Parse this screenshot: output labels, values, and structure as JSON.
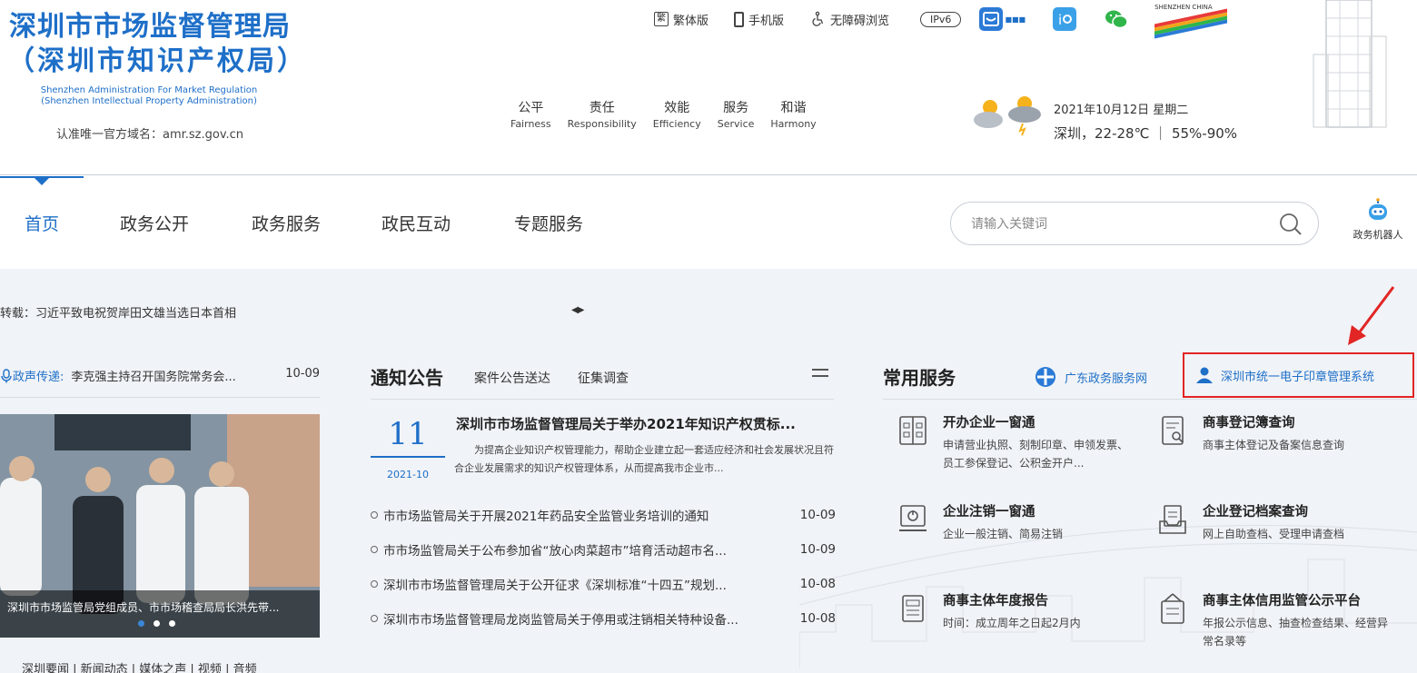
{
  "header": {
    "logo_cn_line1": "深圳市市场监督管理局",
    "logo_cn_line2": "（深圳市知识产权局）",
    "logo_en_line1": "Shenzhen Administration For Market Regulation",
    "logo_en_line2": "(Shenzhen Intellectual Property Administration)",
    "domain_note": "认准唯一官方域名：amr.sz.gov.cn",
    "toplinks": {
      "traditional_badge": "繁",
      "traditional": "繁体版",
      "mobile": "手机版",
      "accessible": "无障碍浏览",
      "ipv6": "IPv6"
    },
    "brand_text": "SHENZHEN CHINA",
    "values": [
      {
        "cn": "公平",
        "en": "Fairness"
      },
      {
        "cn": "责任",
        "en": "Responsibility"
      },
      {
        "cn": "效能",
        "en": "Efficiency"
      },
      {
        "cn": "服务",
        "en": "Service"
      },
      {
        "cn": "和谐",
        "en": "Harmony"
      }
    ],
    "date": "2021年10月12日 星期二",
    "weather": "深圳，22-28℃ ｜ 55%-90%"
  },
  "nav": {
    "items": [
      "首页",
      "政务公开",
      "政务服务",
      "政民互动",
      "专题服务"
    ],
    "active_index": 0,
    "search_placeholder": "请输入关键词",
    "robot_label": "政务机器人"
  },
  "main": {
    "ticker": "转载：习近平致电祝贺岸田文雄当选日本首相",
    "voice": {
      "tag": "政声传递:",
      "title": "李克强主持召开国务院常务会...",
      "date": "10-09"
    },
    "photo_caption": "深圳市市场监管局党组成员、市市场稽查局局长洪先带...",
    "bottom_links": "深圳要闻 | 新闻动态 | 媒体之声 | 视频 | 音频",
    "notices": {
      "title": "通知公告",
      "tabs": [
        "案件公告送达",
        "征集调查"
      ],
      "feature": {
        "day": "11",
        "ym": "2021-10",
        "title": "深圳市市场监督管理局关于举办2021年知识产权贯标...",
        "summary": "为提高企业知识产权管理能力，帮助企业建立起一套适应经济和社会发展状况且符合企业发展需求的知识产权管理体系，从而提高我市企业市..."
      },
      "list": [
        {
          "title": "市市场监管局关于开展2021年药品安全监管业务培训的通知",
          "date": "10-09"
        },
        {
          "title": "市市场监管局关于公布参加省“放心肉菜超市”培育活动超市名...",
          "date": "10-09"
        },
        {
          "title": "深圳市市场监督管理局关于公开征求《深圳标准“十四五”规划...",
          "date": "10-08"
        },
        {
          "title": "深圳市市场监督管理局龙岗监管局关于停用或注销相关特种设备...",
          "date": "10-08"
        }
      ]
    },
    "services": {
      "title": "常用服务",
      "gd_link": "广东政务服务网",
      "seal_link": "深圳市统一电子印章管理系统",
      "items": [
        {
          "name": "开办企业一窗通",
          "desc": "申请营业执照、刻制印章、申领发票、员工参保登记、公积金开户..."
        },
        {
          "name": "商事登记簿查询",
          "desc": "商事主体登记及备案信息查询"
        },
        {
          "name": "企业注销一窗通",
          "desc": "企业一般注销、简易注销"
        },
        {
          "name": "企业登记档案查询",
          "desc": "网上自助查档、受理申请查档"
        },
        {
          "name": "商事主体年度报告",
          "desc": "时间：成立周年之日起2月内"
        },
        {
          "name": "商事主体信用监管公示平台",
          "desc": "年报公示信息、抽查检查结果、经营异常名录等"
        }
      ]
    }
  },
  "colors": {
    "brand": "#1e6fc8",
    "highlight": "#e22525",
    "main_bg": "#f0f3f7"
  }
}
